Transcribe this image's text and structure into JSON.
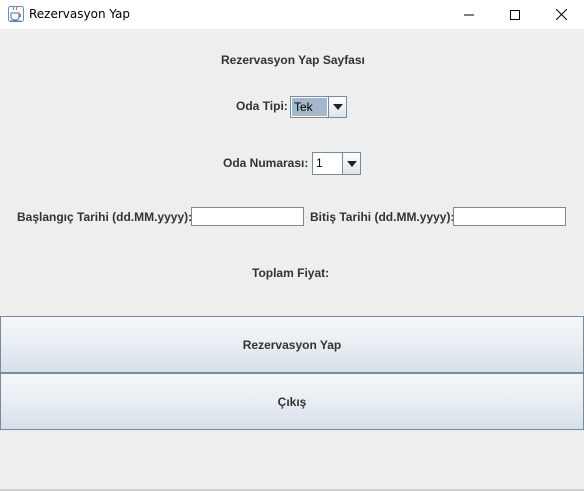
{
  "window": {
    "title": "Rezervasyon Yap",
    "app_icon": "java-cup-icon",
    "controls": [
      "minimize-icon",
      "maximize-icon",
      "close-icon"
    ]
  },
  "form": {
    "heading": "Rezervasyon Yap Sayfası",
    "room_type": {
      "label": "Oda Tipi:",
      "selected": "Tek"
    },
    "room_number": {
      "label": "Oda Numarası:",
      "selected": "1"
    },
    "start_date": {
      "label": "Başlangıç Tarihi (dd.MM.yyyy):",
      "value": ""
    },
    "end_date": {
      "label": "Bitiş Tarihi (dd.MM.yyyy):",
      "value": ""
    },
    "total_price": {
      "label": "Toplam Fiyat:",
      "value": ""
    }
  },
  "buttons": {
    "reserve": "Rezervasyon Yap",
    "exit": "Çıkış"
  },
  "colors": {
    "background": "#eeeeee",
    "selected_highlight": "#a3b8cc",
    "border": "#7a8a99"
  }
}
